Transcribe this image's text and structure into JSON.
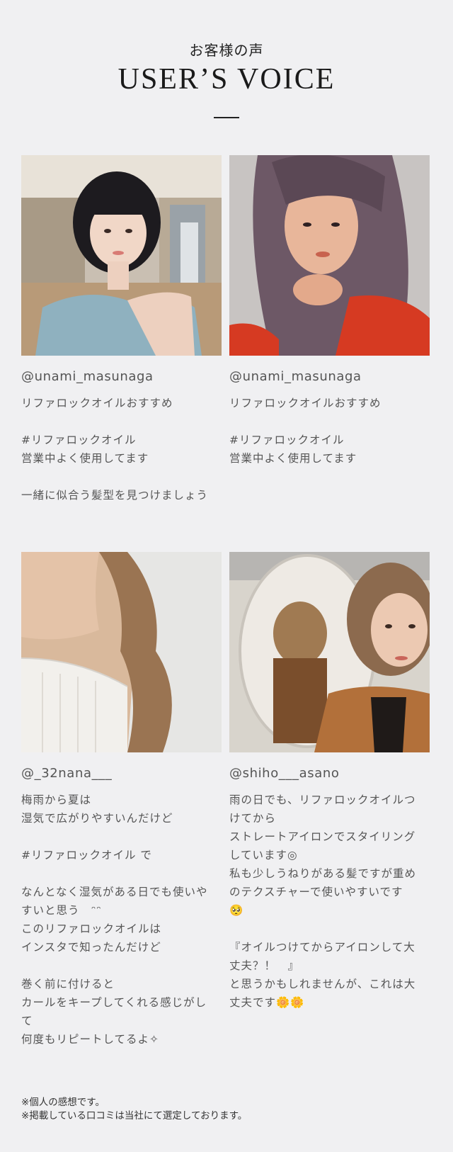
{
  "header": {
    "subtitle": "お客様の声",
    "title": "USER’S VOICE"
  },
  "reviews": [
    {
      "handle": "@unami_masunaga",
      "text": "リファロックオイルおすすめ\n\n#リファロックオイル\n営業中よく使用してます\n\n一緒に似合う髪型を見つけましょう"
    },
    {
      "handle": "@unami_masunaga",
      "text": "リファロックオイルおすすめ\n\n#リファロックオイル\n営業中よく使用してます"
    },
    {
      "handle": "@_32nana___",
      "text": "梅雨から夏は\n湿気で広がりやすいんだけど\n\n#リファロックオイル で\n\nなんとなく湿気がある日でも使いや\nすいと思う　ᵔᵔ\nこのリファロックオイルは\nインスタで知ったんだけど\n\n巻く前に付けると\nカールをキープしてくれる感じがし\nて\n何度もリピートしてるよ✧"
    },
    {
      "handle": "@shiho___asano",
      "text": "雨の日でも、リファロックオイルつ\nけてから\nストレートアイロンでスタイリング\nしています◎\n私も少しうねりがある髪ですが重め\nのテクスチャーで使いやすいです\n🥺\n\n『オイルつけてからアイロンして大\n丈夫？！　』\nと思うかもしれませんが、これは大\n丈夫です🌼🌼"
    }
  ],
  "footnote": "※個人の感想です。\n※掲載している口コミは当社にて選定しております。"
}
